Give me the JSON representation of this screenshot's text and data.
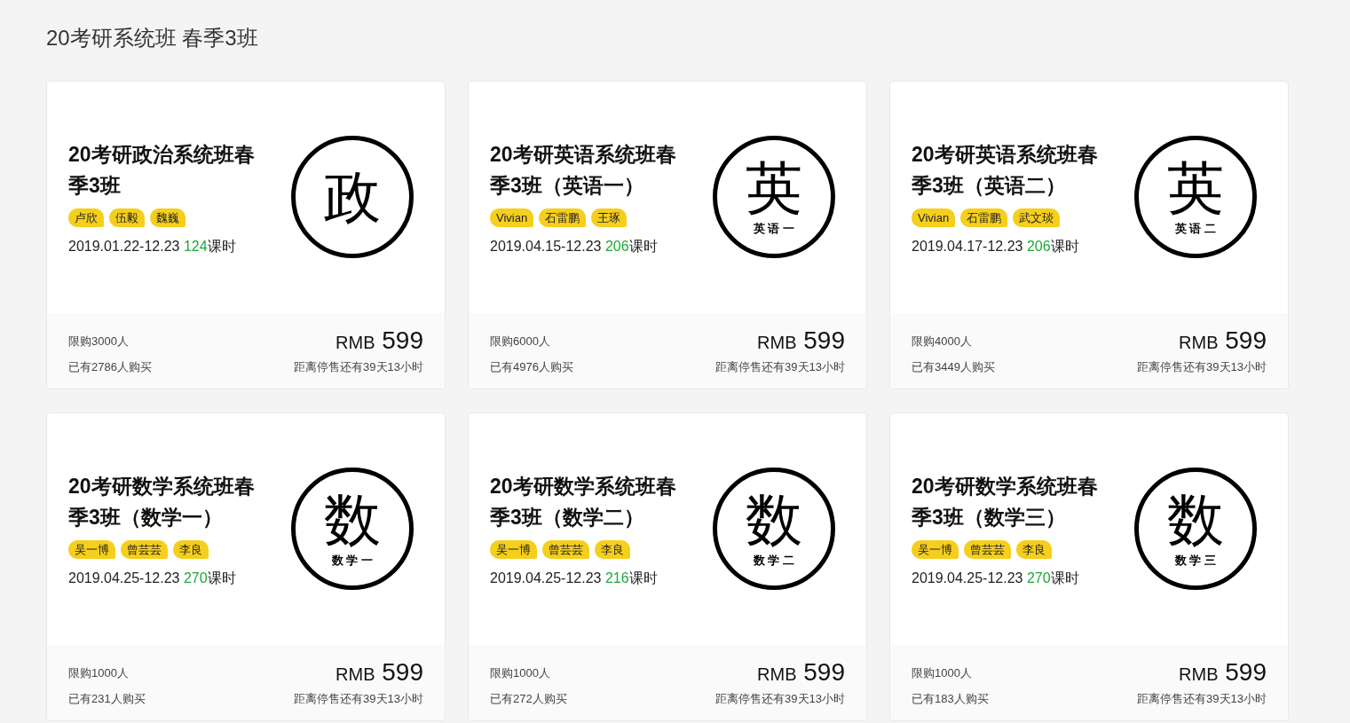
{
  "page_title": "20考研系统班 春季3班",
  "courses": [
    {
      "title": "20考研政治系统班春季3班",
      "badge_char": "政",
      "teachers": [
        "卢欣",
        "伍毅",
        "魏巍"
      ],
      "date": "2019.01.22-12.23",
      "hours": "124",
      "hours_unit": "课时",
      "limit": "限购3000人",
      "bought": "已有2786人购买",
      "currency": "RMB",
      "price": "599",
      "countdown": "距离停售还有39天13小时"
    },
    {
      "title": "20考研英语系统班春季3班（英语一）",
      "badge_char": "英",
      "badge_sub": "英 语 一",
      "teachers": [
        "Vivian",
        "石雷鹏",
        "王琢"
      ],
      "date": "2019.04.15-12.23",
      "hours": "206",
      "hours_unit": "课时",
      "limit": "限购6000人",
      "bought": "已有4976人购买",
      "currency": "RMB",
      "price": "599",
      "countdown": "距离停售还有39天13小时"
    },
    {
      "title": "20考研英语系统班春季3班（英语二）",
      "badge_char": "英",
      "badge_sub": "英 语 二",
      "teachers": [
        "Vivian",
        "石雷鹏",
        "武文琰"
      ],
      "date": "2019.04.17-12.23",
      "hours": "206",
      "hours_unit": "课时",
      "limit": "限购4000人",
      "bought": "已有3449人购买",
      "currency": "RMB",
      "price": "599",
      "countdown": "距离停售还有39天13小时"
    },
    {
      "title": "20考研数学系统班春季3班（数学一）",
      "badge_char": "数",
      "badge_sub": "数 学 一",
      "teachers": [
        "吴一博",
        "曾芸芸",
        "李良"
      ],
      "date": "2019.04.25-12.23",
      "hours": "270",
      "hours_unit": "课时",
      "limit": "限购1000人",
      "bought": "已有231人购买",
      "currency": "RMB",
      "price": "599",
      "countdown": "距离停售还有39天13小时"
    },
    {
      "title": "20考研数学系统班春季3班（数学二）",
      "badge_char": "数",
      "badge_sub": "数 学 二",
      "teachers": [
        "吴一博",
        "曾芸芸",
        "李良"
      ],
      "date": "2019.04.25-12.23",
      "hours": "216",
      "hours_unit": "课时",
      "limit": "限购1000人",
      "bought": "已有272人购买",
      "currency": "RMB",
      "price": "599",
      "countdown": "距离停售还有39天13小时"
    },
    {
      "title": "20考研数学系统班春季3班（数学三）",
      "badge_char": "数",
      "badge_sub": "数 学 三",
      "teachers": [
        "吴一博",
        "曾芸芸",
        "李良"
      ],
      "date": "2019.04.25-12.23",
      "hours": "270",
      "hours_unit": "课时",
      "limit": "限购1000人",
      "bought": "已有183人购买",
      "currency": "RMB",
      "price": "599",
      "countdown": "距离停售还有39天13小时"
    }
  ]
}
